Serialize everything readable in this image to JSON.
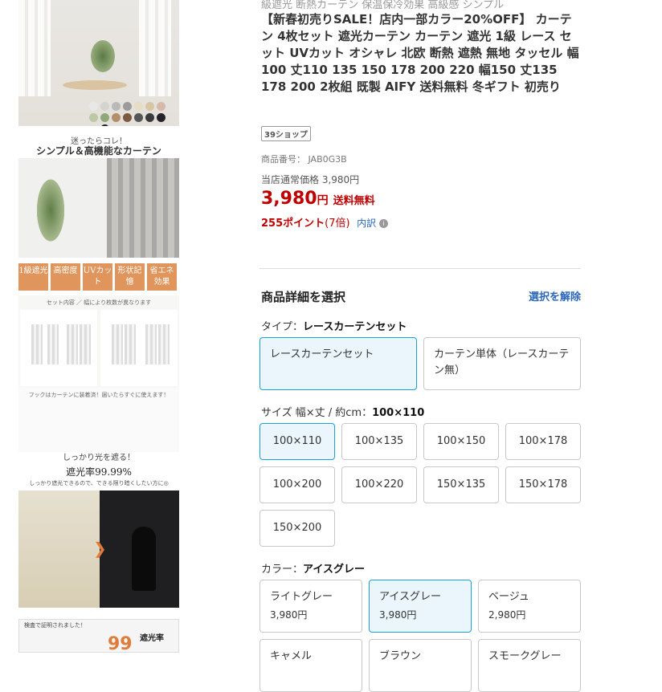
{
  "gallery": {
    "swatch_colors": [
      "#e8e8e6",
      "#d3d3d0",
      "#b9bab8",
      "#9b9c9a",
      "#e7dcc4",
      "#d8c5a3",
      "#d6b9a8",
      "#bcc8a6",
      "#8fa878",
      "#b38e6a",
      "#7b5a42",
      "#555658",
      "#3a3b3d",
      "#22242a",
      "#e2e0dc",
      "#1a1a1a"
    ],
    "cap_a": "迷ったらコレ！",
    "cap_b": "シンプル＆高機能なカーテン",
    "badges": [
      "1級遮光",
      "高密度",
      "UVカット",
      "形状記憶",
      "省エネ効果"
    ],
    "set_header": "セット内容",
    "set_note": "幅により枚数が異なります",
    "hook_note": "フックはカーテンに装着済！届いたらすぐに使えます！",
    "cap_c": "しっかり光を遮る！",
    "cap_d": "遮光率99.99%",
    "cap_e": "しっかり遮光できるので、できる限り暗くしたい方に◎",
    "bottom_caption": "検査で証明されました！",
    "bottom_big": "99",
    "bottom_tag": "遮光率"
  },
  "product": {
    "tags": "級遮光 断熱カーテン 保温保冷効果 高級感 シンプル",
    "title": "【新春初売りSALE！店内一部カラー20%OFF】 カーテン 4枚セット 遮光カーテン カーテン 遮光 1級 レース セット UVカット オシャレ 北欧 断熱 遮熱 無地 タッセル 幅100 丈110 135 150 178 200 220 幅150 丈135 178 200 2枚組 既製 AIFY 送料無料 冬ギフト 初売り",
    "shop_badge": "39ショップ",
    "sku": "商品番号： JAB0G3B",
    "regular_price": "当店通常価格 3,980円",
    "price": "3,980",
    "yen": "円",
    "shipping": "送料無料",
    "points": "255ポイント",
    "points_rate": "(7倍)",
    "points_link": "内訳",
    "info_icon": "i"
  },
  "selector": {
    "heading": "商品詳細を選択",
    "clear_label": "選択を解除",
    "type_label": "タイプ：",
    "type_value": "レースカーテンセット",
    "types": [
      "レースカーテンセット",
      "カーテン単体（レースカーテン無）"
    ],
    "size_label": "サイズ 幅×丈 / 約cm：",
    "size_value": "100×110",
    "sizes": [
      "100×110",
      "100×135",
      "100×150",
      "100×178",
      "100×200",
      "100×220",
      "150×135",
      "150×178",
      "150×200"
    ],
    "color_label": "カラー：",
    "color_value": "アイスグレー",
    "colors": [
      {
        "name": "ライトグレー",
        "price": "3,980円"
      },
      {
        "name": "アイスグレー",
        "price": "3,980円"
      },
      {
        "name": "ベージュ",
        "price": "2,980円"
      },
      {
        "name": "キャメル",
        "price": ""
      },
      {
        "name": "ブラウン",
        "price": ""
      },
      {
        "name": "スモークグレー",
        "price": ""
      }
    ],
    "selected_type": 0,
    "selected_size": 0,
    "selected_color": 1
  }
}
